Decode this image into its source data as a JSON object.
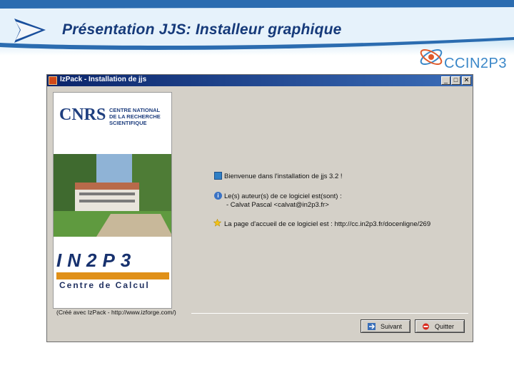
{
  "slide": {
    "title": "Présentation JJS: Installeur graphique",
    "logo_text": "CCIN2P3",
    "play_icon": "play-arrow-icon",
    "colors": {
      "title": "#163a7a",
      "header_blue": "#2b6cb0",
      "logo": "#3a87c8"
    }
  },
  "window": {
    "title": "IzPack - Installation de jjs",
    "controls": {
      "minimize": "_",
      "maximize": "□",
      "close": "✕"
    },
    "side_panel": {
      "cnrs_logo_text": "CNRS",
      "cnrs_caption": "CENTRE NATIONAL\nDE LA RECHERCHE\nSCIENTIFIQUE",
      "in2p3_text": "IN2P3",
      "centre_text": "Centre de Calcul"
    },
    "welcome_text": "Bienvenue dans l'installation de jjs 3.2 !",
    "authors_label": "Le(s) auteur(s) de ce logiciel est(sont) :",
    "author": "- Calvat Pascal <calvat@in2p3.fr>",
    "homepage": "La page d'accueil de ce logiciel est : http://cc.in2p3.fr/docenligne/269",
    "credit": "(Créé avec IzPack - http://www.izforge.com/)",
    "buttons": {
      "next_label": "Suivant",
      "quit_label": "Quitter"
    }
  }
}
